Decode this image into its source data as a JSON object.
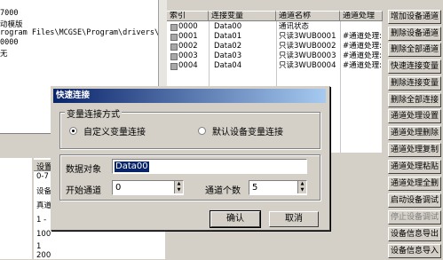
{
  "left_pane": {
    "lines": [
      "7000",
      "动模版",
      "rogram Files\\MCGSE\\Program\\drivers\\p",
      "0000",
      "无"
    ]
  },
  "table": {
    "headers": [
      "索引",
      "连接变量",
      "通道名称",
      "通道处理"
    ],
    "rows": [
      {
        "index": "0000",
        "var": "Data00",
        "name": "通讯状态",
        "proc": ""
      },
      {
        "index": "0001",
        "var": "Data01",
        "name": "只读3WUB0001",
        "proc": "#通道处理:"
      },
      {
        "index": "0002",
        "var": "Data02",
        "name": "只读3WUB0002",
        "proc": "#通道处理:"
      },
      {
        "index": "0003",
        "var": "Data03",
        "name": "只读3WUB0003",
        "proc": "#通道处理:"
      },
      {
        "index": "0004",
        "var": "Data04",
        "name": "只读3WUB0004",
        "proc": "#通道处理:"
      }
    ]
  },
  "right_buttons": [
    {
      "label": "增加设备通道",
      "enabled": true
    },
    {
      "label": "删除设备通道",
      "enabled": true
    },
    {
      "label": "删除全部通道",
      "enabled": true
    },
    {
      "label": "快速连接变量",
      "enabled": true
    },
    {
      "label": "删除连接变量",
      "enabled": true
    },
    {
      "label": "删除全部连接",
      "enabled": true
    },
    {
      "label": "通道处理设置",
      "enabled": true
    },
    {
      "label": "通道处理删除",
      "enabled": true
    },
    {
      "label": "通道处理复制",
      "enabled": true
    },
    {
      "label": "通道处理粘贴",
      "enabled": true
    },
    {
      "label": "通道处理全删",
      "enabled": true
    },
    {
      "label": "启动设备调试",
      "enabled": true
    },
    {
      "label": "停止设备调试",
      "enabled": false
    },
    {
      "label": "设备信息导出",
      "enabled": true
    },
    {
      "label": "设备信息导入",
      "enabled": true
    }
  ],
  "lower_left": {
    "col_header": "设置",
    "rows": [
      "0-7",
      "设备",
      "真道",
      "1 -",
      "100",
      "1",
      "1"
    ],
    "bottom": "200"
  },
  "dialog": {
    "title": "快速连接",
    "group_label": "变量连接方式",
    "radio_custom": "自定义变量连接",
    "radio_default": "默认设备变量连接",
    "data_object_label": "数据对象",
    "data_object_value": "Data00",
    "start_channel_label": "开始通道",
    "start_channel_value": "0",
    "channel_count_label": "通道个数",
    "channel_count_value": "5",
    "ok_label": "确认",
    "cancel_label": "取消"
  }
}
